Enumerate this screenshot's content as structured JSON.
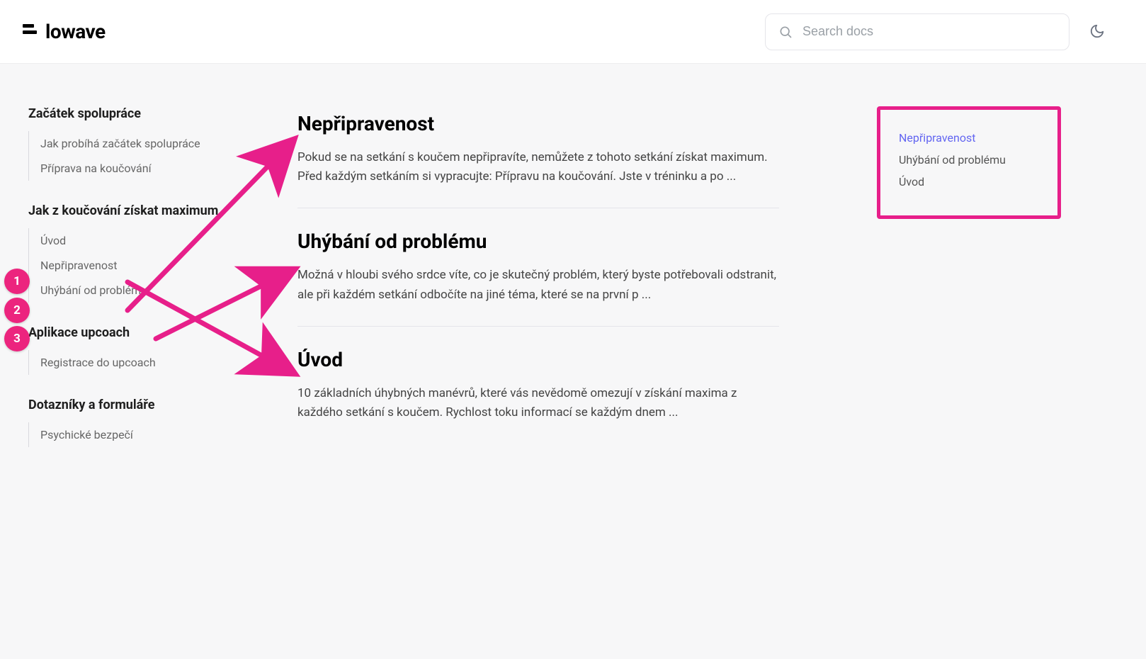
{
  "logo_text": "lowave",
  "search": {
    "placeholder": "Search docs"
  },
  "sidebar": {
    "sections": [
      {
        "title": "Začátek spolupráce",
        "items": [
          "Jak probíhá začátek spolupráce",
          "Příprava na koučování"
        ]
      },
      {
        "title": "Jak z koučování získat maximum",
        "items": [
          "Úvod",
          "Nepřipravenost",
          "Uhýbání od problému"
        ]
      },
      {
        "title": "Aplikace upcoach",
        "items": [
          "Registrace do upcoach"
        ]
      },
      {
        "title": "Dotazníky a formuláře",
        "items": [
          "Psychické bezpečí"
        ]
      }
    ]
  },
  "articles": [
    {
      "title": "Nepřipravenost",
      "excerpt": "Pokud se na setkání s koučem nepřipravíte, nemůžete z tohoto setkání získat maximum. Před každým setkáním si vypracujte: Přípravu na koučování. Jste v tréninku a po ..."
    },
    {
      "title": "Uhýbání od problému",
      "excerpt": "Možná v hloubi svého srdce víte, co je skutečný problém, který byste potřebovali odstranit, ale při každém setkání odbočíte na jiné téma, které se na první p ..."
    },
    {
      "title": "Úvod",
      "excerpt": "10 základních úhybných manévrů, které vás nevědomě omezují v získání maxima z každého setkání s koučem. Rychlost toku informací se každým dnem ..."
    }
  ],
  "toc": {
    "items": [
      {
        "label": "Nepřipravenost",
        "active": true
      },
      {
        "label": "Uhýbání od problému",
        "active": false
      },
      {
        "label": "Úvod",
        "active": false
      }
    ]
  },
  "annotations": {
    "badges": [
      "1",
      "2",
      "3"
    ],
    "color": "#E71F8A"
  }
}
